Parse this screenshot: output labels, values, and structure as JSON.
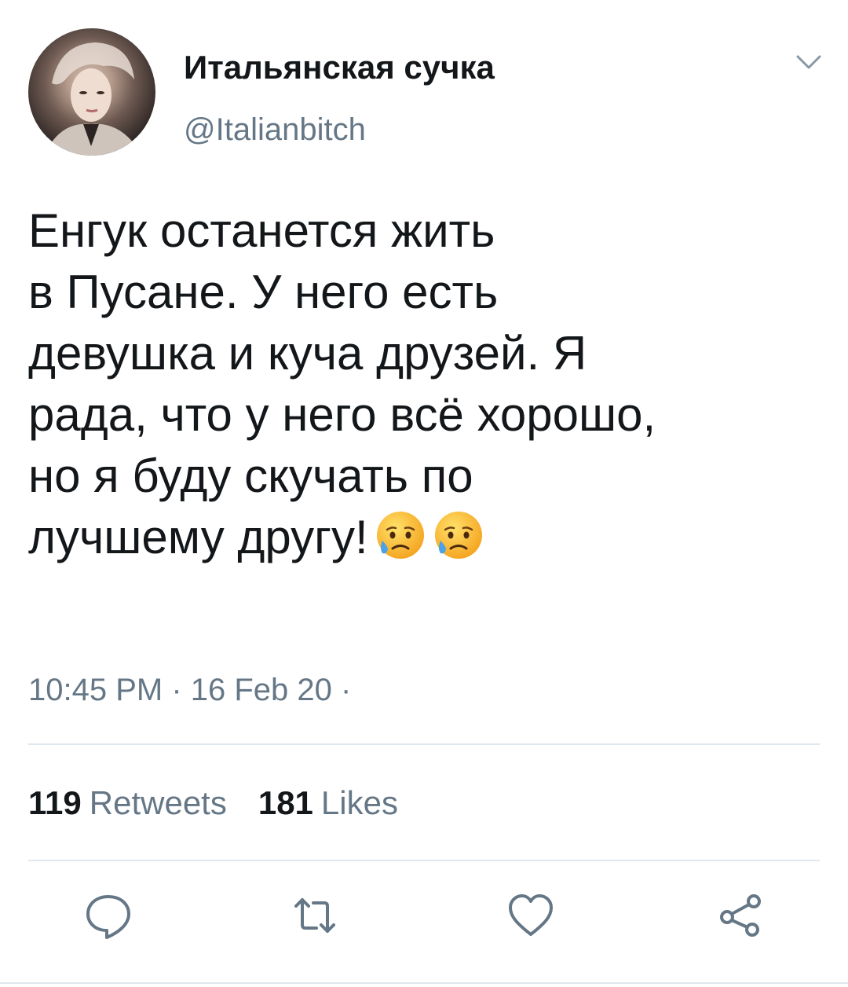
{
  "tweet": {
    "display_name": "Итальянская сучка",
    "handle": "@Italianbitch",
    "avatar_icon": "profile-photo",
    "text": "Енгук останется жить\nв Пусане. У него есть\nдевушка и куча друзей. Я\nрада, что у него всё хорошо,\nно я буду скучать по\nлучшему другу!",
    "emojis": [
      "sad-but-relieved-face",
      "sad-but-relieved-face"
    ],
    "timestamp": "10:45 PM · 16 Feb 20 ·"
  },
  "stats": {
    "retweets_count": "119",
    "retweets_label": "Retweets",
    "likes_count": "181",
    "likes_label": "Likes"
  },
  "actions": {
    "icons": [
      "reply-icon",
      "retweet-icon",
      "like-icon",
      "share-icon"
    ]
  },
  "colors": {
    "text": "#14171a",
    "secondary": "#657786",
    "divider": "#e1e8ed"
  }
}
